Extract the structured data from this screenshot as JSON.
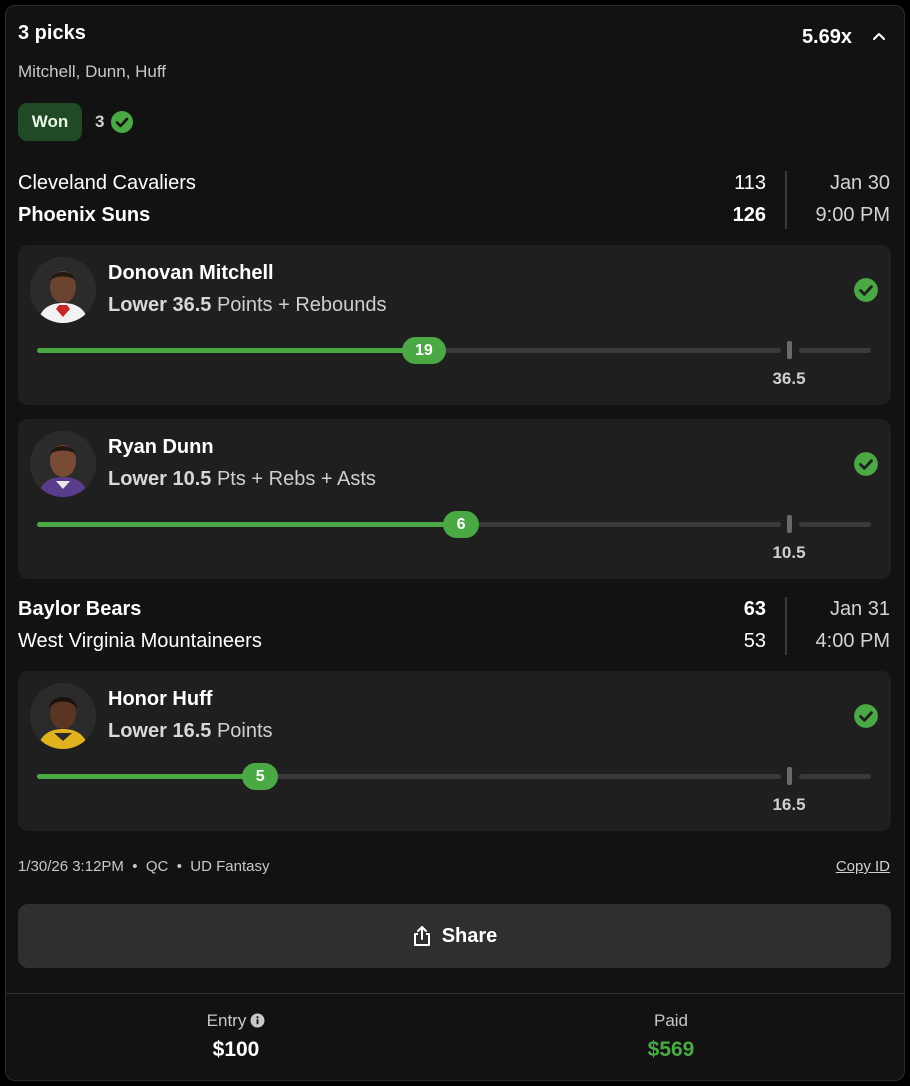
{
  "header": {
    "title": "3 picks",
    "multiplier": "5.69x",
    "players": "Mitchell, Dunn, Huff",
    "status": "Won",
    "won_count": "3"
  },
  "games": [
    {
      "team1": "Cleveland Cavaliers",
      "score1": "113",
      "team2": "Phoenix Suns",
      "score2": "126",
      "date": "Jan 30",
      "time": "9:00 PM"
    },
    {
      "team1": "Baylor Bears",
      "score1": "63",
      "team2": "West Virginia Mountaineers",
      "score2": "53",
      "date": "Jan 31",
      "time": "4:00 PM"
    }
  ],
  "picks": [
    {
      "name": "Donovan Mitchell",
      "direction_line": "Lower 36.5",
      "stat": "Points + Rebounds",
      "actual": "19",
      "line": "36.5",
      "progress": 0.52
    },
    {
      "name": "Ryan Dunn",
      "direction_line": "Lower 10.5",
      "stat": "Pts + Rebs + Asts",
      "actual": "6",
      "line": "10.5",
      "progress": 0.57
    },
    {
      "name": "Honor Huff",
      "direction_line": "Lower 16.5",
      "stat": "Points",
      "actual": "5",
      "line": "16.5",
      "progress": 0.3
    }
  ],
  "meta": {
    "timestamp": "1/30/26 3:12PM",
    "region": "QC",
    "platform": "UD Fantasy",
    "copy_id": "Copy ID"
  },
  "share_label": "Share",
  "footer": {
    "entry_label": "Entry",
    "entry_value": "$100",
    "paid_label": "Paid",
    "paid_value": "$569"
  },
  "colors": {
    "accent_green": "#4aa944",
    "badge_bg": "#1f4a25",
    "card_bg": "#121212",
    "pick_bg": "#1f1f1f"
  }
}
